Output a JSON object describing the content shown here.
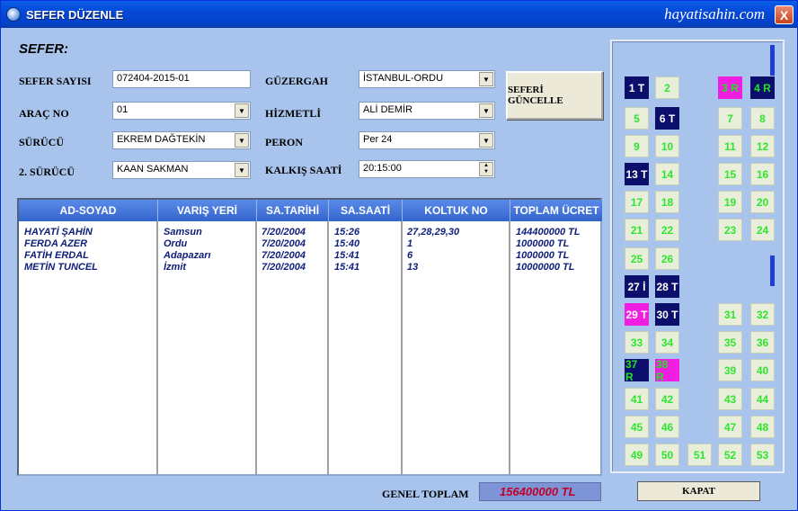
{
  "window": {
    "title": "SEFER DÜZENLE",
    "brand": "hayatisahin.com",
    "close_glyph": "X"
  },
  "form": {
    "section_title": "SEFER:",
    "sefer_sayisi": {
      "label": "SEFER SAYISI",
      "value": "072404-2015-01"
    },
    "arac_no": {
      "label": "ARAÇ NO",
      "value": "01"
    },
    "surucu": {
      "label": "SÜRÜCÜ",
      "value": "EKREM DAĞTEKİN"
    },
    "surucu2": {
      "label": "2. SÜRÜCÜ",
      "value": "KAAN SAKMAN"
    },
    "guzergah": {
      "label": "GÜZERGAH",
      "value": "İSTANBUL-ORDU"
    },
    "hizmetli": {
      "label": "HİZMETLİ",
      "value": "ALİ DEMİR"
    },
    "peron": {
      "label": "PERON",
      "value": "Per 24"
    },
    "kalkis_saati": {
      "label": "KALKIŞ SAATİ",
      "value": "20:15:00"
    },
    "update_button": "SEFERİ GÜNCELLE"
  },
  "grid": {
    "columns": [
      "AD-SOYAD",
      "VARIŞ YERİ",
      "SA.TARİHİ",
      "SA.SAATİ",
      "KOLTUK NO",
      "TOPLAM ÜCRET"
    ],
    "rows": [
      [
        "HAYATİ ŞAHİN",
        "Samsun",
        "7/20/2004",
        "15:26",
        "27,28,29,30",
        "144400000 TL"
      ],
      [
        "FERDA AZER",
        "Ordu",
        "7/20/2004",
        "15:40",
        "1",
        "1000000 TL"
      ],
      [
        "FATİH ERDAL",
        "Adapazarı",
        "7/20/2004",
        "15:41",
        "6",
        "1000000 TL"
      ],
      [
        "METİN TUNCEL",
        "İzmit",
        "7/20/2004",
        "15:41",
        "13",
        "10000000 TL"
      ]
    ]
  },
  "footer": {
    "total_label": "GENEL TOPLAM",
    "total_value": "156400000 TL",
    "close_button": "KAPAT"
  },
  "seats": [
    {
      "label": "1 T",
      "state": "navy"
    },
    {
      "label": "2",
      "state": "plain"
    },
    {
      "label": "3 R",
      "state": "magenta-green"
    },
    {
      "label": "4 R",
      "state": "navy-green"
    },
    {
      "label": "5",
      "state": "plain"
    },
    {
      "label": "6 T",
      "state": "navy"
    },
    {
      "label": "7",
      "state": "plain"
    },
    {
      "label": "8",
      "state": "plain"
    },
    {
      "label": "9",
      "state": "plain"
    },
    {
      "label": "10",
      "state": "plain"
    },
    {
      "label": "11",
      "state": "plain"
    },
    {
      "label": "12",
      "state": "plain"
    },
    {
      "label": "13 T",
      "state": "navy"
    },
    {
      "label": "14",
      "state": "plain"
    },
    {
      "label": "15",
      "state": "plain"
    },
    {
      "label": "16",
      "state": "plain"
    },
    {
      "label": "17",
      "state": "plain"
    },
    {
      "label": "18",
      "state": "plain"
    },
    {
      "label": "19",
      "state": "plain"
    },
    {
      "label": "20",
      "state": "plain"
    },
    {
      "label": "21",
      "state": "plain"
    },
    {
      "label": "22",
      "state": "plain"
    },
    {
      "label": "23",
      "state": "plain"
    },
    {
      "label": "24",
      "state": "plain"
    },
    {
      "label": "25",
      "state": "plain"
    },
    {
      "label": "26",
      "state": "plain"
    },
    {
      "label": "27 İ",
      "state": "navy"
    },
    {
      "label": "28 T",
      "state": "navy"
    },
    {
      "label": "29 T",
      "state": "magenta"
    },
    {
      "label": "30 T",
      "state": "navy"
    },
    {
      "label": "31",
      "state": "plain"
    },
    {
      "label": "32",
      "state": "plain"
    },
    {
      "label": "33",
      "state": "plain"
    },
    {
      "label": "34",
      "state": "plain"
    },
    {
      "label": "35",
      "state": "plain"
    },
    {
      "label": "36",
      "state": "plain"
    },
    {
      "label": "37 R",
      "state": "navy-green"
    },
    {
      "label": "38 R",
      "state": "magenta-green"
    },
    {
      "label": "39",
      "state": "plain"
    },
    {
      "label": "40",
      "state": "plain"
    },
    {
      "label": "41",
      "state": "plain"
    },
    {
      "label": "42",
      "state": "plain"
    },
    {
      "label": "43",
      "state": "plain"
    },
    {
      "label": "44",
      "state": "plain"
    },
    {
      "label": "45",
      "state": "plain"
    },
    {
      "label": "46",
      "state": "plain"
    },
    {
      "label": "47",
      "state": "plain"
    },
    {
      "label": "48",
      "state": "plain"
    },
    {
      "label": "49",
      "state": "plain"
    },
    {
      "label": "50",
      "state": "plain"
    },
    {
      "label": "51",
      "state": "plain"
    },
    {
      "label": "52",
      "state": "plain"
    },
    {
      "label": "53",
      "state": "plain"
    }
  ]
}
